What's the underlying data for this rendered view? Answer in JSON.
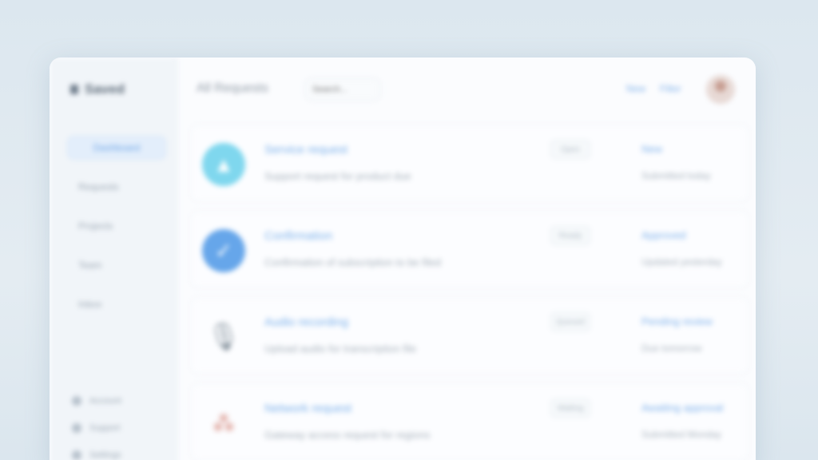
{
  "app": {
    "title": "Saved"
  },
  "sidebar": {
    "items": [
      {
        "label": "Dashboard",
        "active": true
      },
      {
        "label": "Requests"
      },
      {
        "label": "Projects"
      },
      {
        "label": "Team"
      },
      {
        "label": "Inbox"
      }
    ],
    "bottom": [
      {
        "label": "Account"
      },
      {
        "label": "Support"
      },
      {
        "label": "Settings"
      }
    ]
  },
  "topbar": {
    "label": "All Requests",
    "search_placeholder": "Search...",
    "links": [
      "New",
      "Filter"
    ]
  },
  "cards": [
    {
      "icon": "tent-icon",
      "glyph": "▲",
      "title": "Service request",
      "subtitle": "Support request for product due",
      "badge": "Open",
      "status": "New",
      "meta": "Submitted today"
    },
    {
      "icon": "check-icon",
      "glyph": "✓",
      "title": "Confirmation",
      "subtitle": "Confirmation of subscription to be filed",
      "badge": "Ready",
      "status": "Approved",
      "meta": "Updated yesterday"
    },
    {
      "icon": "microphone-icon",
      "glyph": "🎙",
      "title": "Audio recording",
      "subtitle": "Upload audio for transcription file",
      "badge": "Queued",
      "status": "Pending review",
      "meta": "Due tomorrow"
    },
    {
      "icon": "network-icon",
      "glyph": "⁂",
      "title": "Network request",
      "subtitle": "Gateway access request for regions",
      "badge": "Waiting",
      "status": "Awaiting approval",
      "meta": "Submitted Monday"
    }
  ]
}
